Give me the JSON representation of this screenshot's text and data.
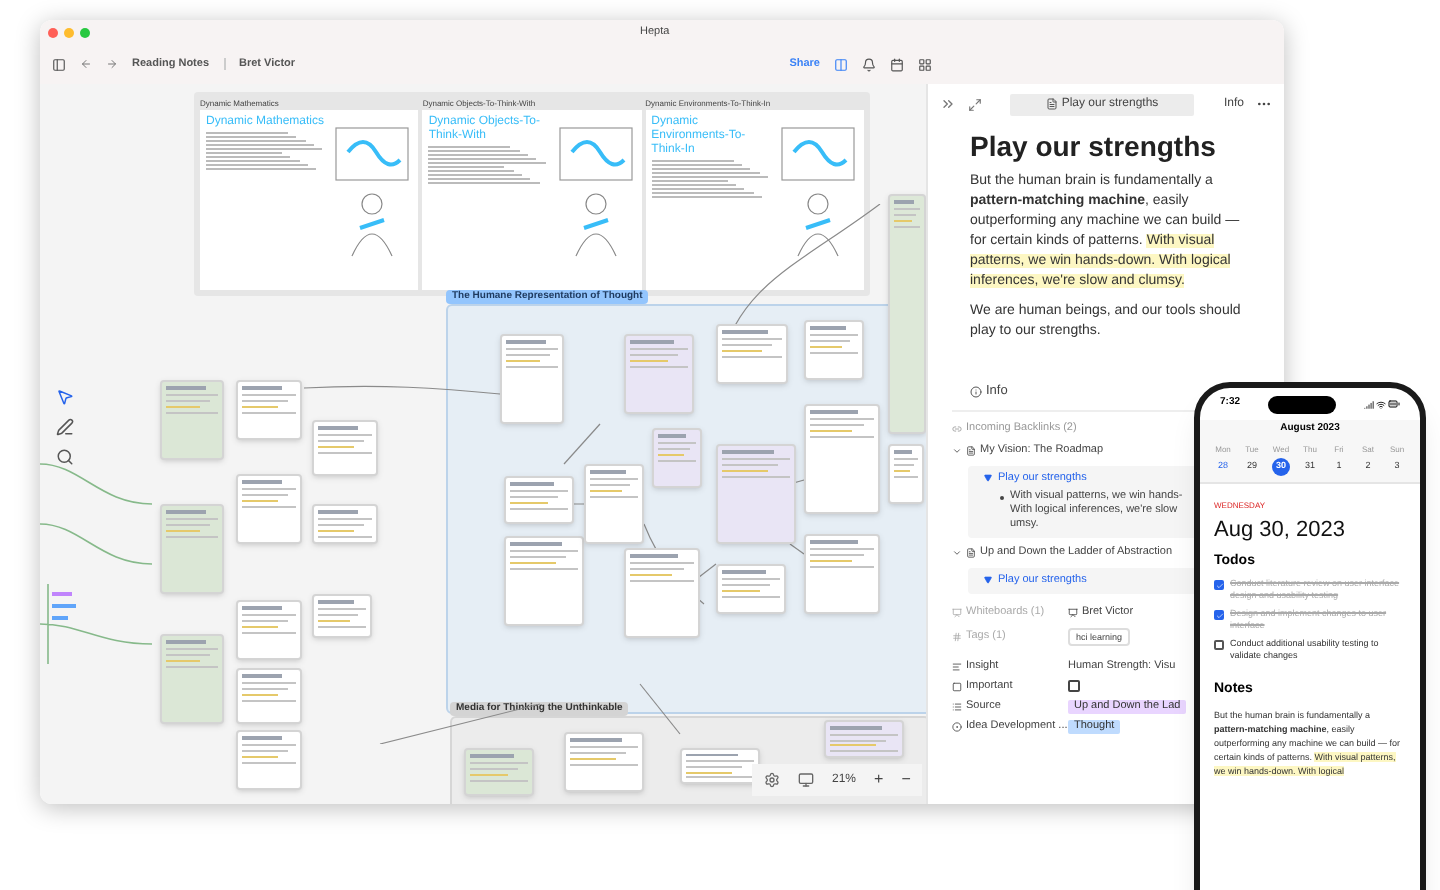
{
  "window": {
    "title": "Hepta"
  },
  "toolbar": {
    "breadcrumbs": [
      "Reading Notes",
      "Bret Victor"
    ],
    "share": "Share"
  },
  "canvas": {
    "panels": [
      {
        "header": "Dynamic Mathematics",
        "title": "Dynamic Mathematics"
      },
      {
        "header": "Dynamic Objects-To-Think-With",
        "title": "Dynamic Objects-To-Think-With"
      },
      {
        "header": "Dynamic Environments-To-Think-In",
        "title": "Dynamic Environments-To-Think-In"
      }
    ],
    "groups": [
      {
        "label": "The Humane Representation of Thought",
        "selected": true
      },
      {
        "label": "Media for Thinking the Unthinkable",
        "selected": false
      }
    ],
    "zoom": {
      "level": "21%",
      "zoom_in": "+",
      "zoom_out": "−"
    }
  },
  "note": {
    "tab": "Play our strengths",
    "info_button": "Info",
    "title": "Play our strengths",
    "body": [
      [
        {
          "text": "But the human brain is fundamentally a **pattern-matching machine**, easily outperforming any machine we can build — for certain kinds of patterns. ",
          "highlight": false
        },
        {
          "text": "With visual patterns, we win hands-down. With logical inferences, we're slow and clumsy.",
          "highlight": true
        }
      ],
      [
        {
          "text": "We are human beings, and our tools should play to our strengths.",
          "highlight": false
        }
      ]
    ]
  },
  "info": {
    "heading": "Info",
    "backlinks_heading": "Incoming Backlinks (2)",
    "backlinks": [
      {
        "title": "My Vision: The Roadmap",
        "expanded": true,
        "link": "Play our strengths",
        "quote": [
          "With visual patterns, we win hands-",
          "With logical inferences, we're slow",
          "umsy."
        ]
      },
      {
        "title": "Up and Down the Ladder of Abstraction",
        "expanded": true,
        "link": "Play our strengths"
      }
    ],
    "whiteboards": {
      "label": "Whiteboards (1)",
      "value": "Bret Victor"
    },
    "tags": {
      "label": "Tags (1)",
      "values": [
        "hci learning"
      ]
    },
    "properties": [
      {
        "kind": "text",
        "label": "Insight",
        "value": "Human Strength: Visu"
      },
      {
        "kind": "checkbox",
        "label": "Important",
        "checked": false
      },
      {
        "kind": "chip",
        "label": "Source",
        "value": "Up and Down the Lad",
        "color": "#e9d5ff"
      },
      {
        "kind": "chip",
        "label": "Idea Development ...",
        "value": "Thought",
        "color": "#bfdbfe"
      }
    ]
  },
  "phone": {
    "time": "7:32",
    "month": "August 2023",
    "days": [
      {
        "weekday": "Mon",
        "date": "28",
        "selected": false,
        "accent": true
      },
      {
        "weekday": "Tue",
        "date": "29",
        "selected": false,
        "accent": false
      },
      {
        "weekday": "Wed",
        "date": "30",
        "selected": true,
        "accent": false
      },
      {
        "weekday": "Thu",
        "date": "31",
        "selected": false,
        "accent": false
      },
      {
        "weekday": "Fri",
        "date": "1",
        "selected": false,
        "accent": false
      },
      {
        "weekday": "Sat",
        "date": "2",
        "selected": false,
        "accent": false
      },
      {
        "weekday": "Sun",
        "date": "3",
        "selected": false,
        "accent": false
      }
    ],
    "day_label": "WEDNESDAY",
    "date": "Aug 30, 2023",
    "todos_heading": "Todos",
    "todos": [
      {
        "text": "Conduct literature review on user interface design and usability testing",
        "checked": true
      },
      {
        "text": "Design and implement changes to user interface",
        "checked": true
      },
      {
        "text": "Conduct additional usability testing to validate changes",
        "checked": false
      }
    ],
    "notes_heading": "Notes",
    "notes": [
      {
        "text": "But the human brain is fundamentally a **pattern-matching machine**, easily outperforming any machine we can build — for certain kinds of patterns. ",
        "highlight": false
      },
      {
        "text": "With visual patterns, we win hands-down. With logical",
        "highlight": true
      }
    ]
  }
}
